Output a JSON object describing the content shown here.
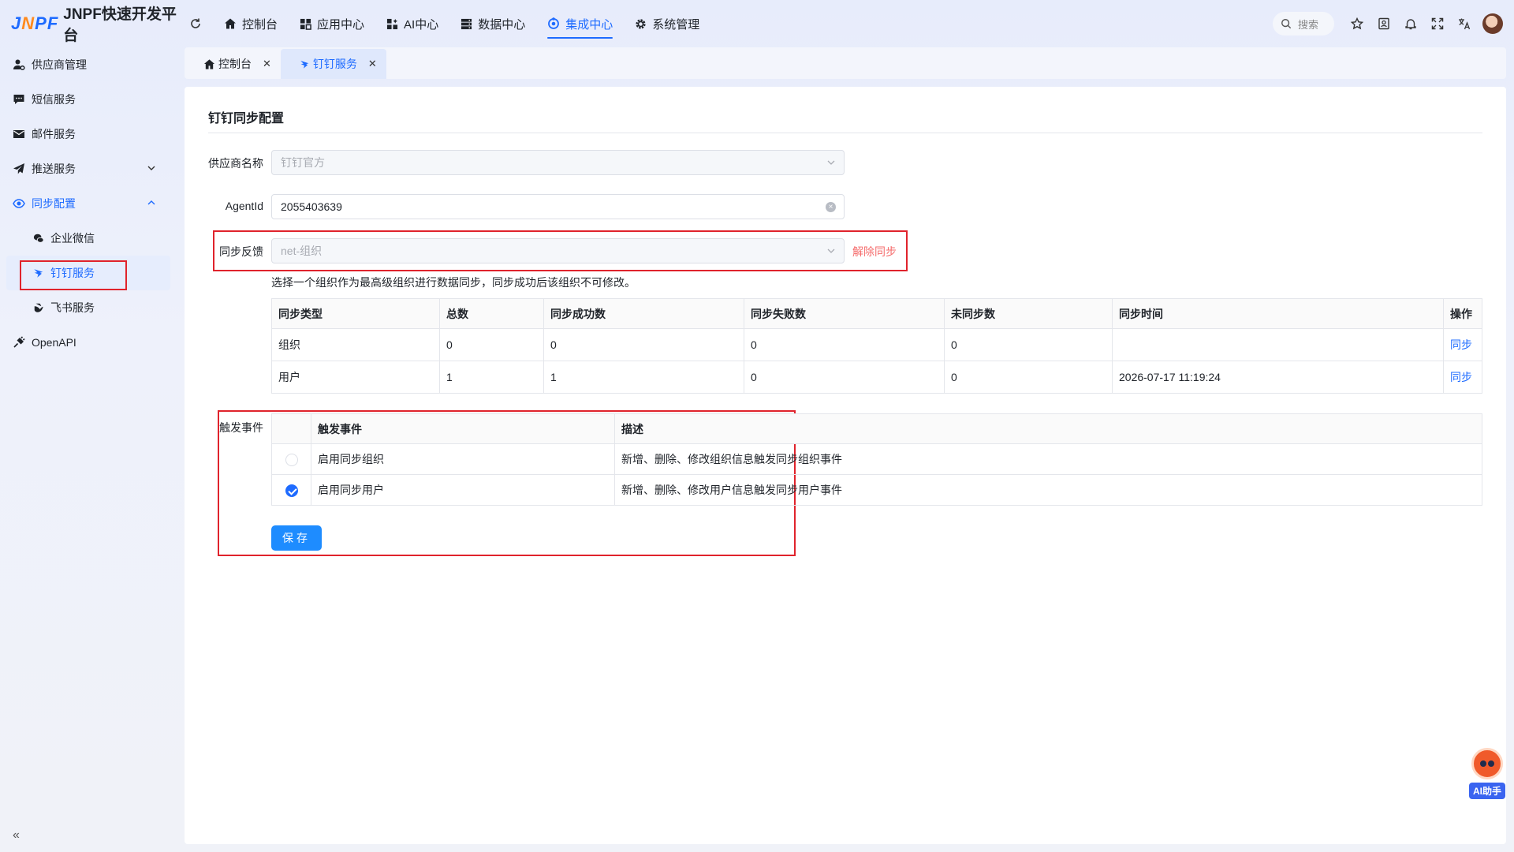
{
  "app": {
    "logo_mark": "JNPF",
    "title": "JNPF快速开发平台"
  },
  "nav": [
    {
      "label": "控制台",
      "icon": "home-icon"
    },
    {
      "label": "应用中心",
      "icon": "grid-icon"
    },
    {
      "label": "AI中心",
      "icon": "ai-grid-icon"
    },
    {
      "label": "数据中心",
      "icon": "database-icon"
    },
    {
      "label": "集成中心",
      "icon": "integration-icon",
      "active": true
    },
    {
      "label": "系统管理",
      "icon": "gear-icon"
    }
  ],
  "search": {
    "placeholder": "搜索"
  },
  "sidebar": {
    "items": [
      {
        "label": "供应商管理"
      },
      {
        "label": "短信服务"
      },
      {
        "label": "邮件服务"
      },
      {
        "label": "推送服务"
      },
      {
        "label": "同步配置"
      },
      {
        "label": "企业微信"
      },
      {
        "label": "钉钉服务"
      },
      {
        "label": "飞书服务"
      },
      {
        "label": "OpenAPI"
      }
    ]
  },
  "tabs": [
    {
      "label": "控制台"
    },
    {
      "label": "钉钉服务"
    }
  ],
  "page": {
    "title": "钉钉同步配置",
    "provider_label": "供应商名称",
    "provider_value": "钉钉官方",
    "agent_label": "AgentId",
    "agent_value": "2055403639",
    "feedback_label": "同步反馈",
    "feedback_value": "net-组织",
    "unsync_link": "解除同步",
    "hint": "选择一个组织作为最高级组织进行数据同步，同步成功后该组织不可修改。",
    "trigger_label": "触发事件",
    "save_label": "保存"
  },
  "sync_table": {
    "headers": [
      "同步类型",
      "总数",
      "同步成功数",
      "同步失败数",
      "未同步数",
      "同步时间",
      "操作"
    ],
    "rows": [
      {
        "type": "组织",
        "total": "0",
        "success": "0",
        "fail": "0",
        "pending": "0",
        "time": "",
        "action": "同步"
      },
      {
        "type": "用户",
        "total": "1",
        "success": "1",
        "fail": "0",
        "pending": "0",
        "time": "2026-07-17 11:19:24",
        "action": "同步"
      }
    ]
  },
  "event_table": {
    "headers": [
      "",
      "触发事件",
      "描述"
    ],
    "rows": [
      {
        "checked": false,
        "event": "启用同步组织",
        "desc": "新增、删除、修改组织信息触发同步组织事件"
      },
      {
        "checked": true,
        "event": "启用同步用户",
        "desc": "新增、删除、修改用户信息触发同步用户事件"
      }
    ]
  },
  "ai_helper": {
    "label": "AI助手"
  },
  "colors": {
    "primary": "#1e6bff",
    "danger": "#f56c6c",
    "highlight_box": "#e0232c"
  }
}
